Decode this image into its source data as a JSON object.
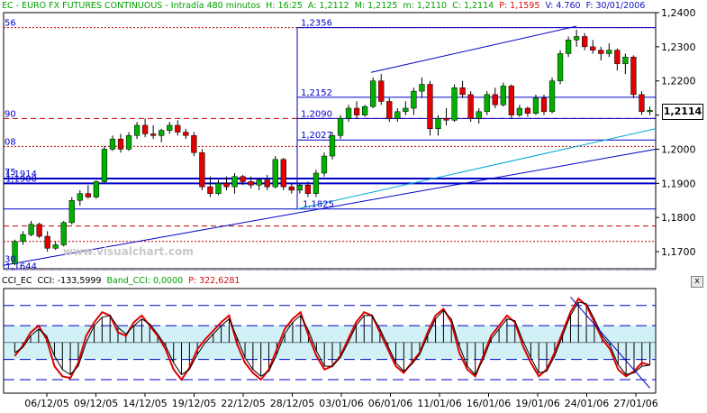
{
  "header": {
    "title": "EC - EURO FX FUTURES CONTINUOUS - Intradía 480 minutos",
    "H": "H: 16:25",
    "A": "A: 1,2112",
    "M": "M: 1,2125",
    "m": "m: 1,2110",
    "C": "C: 1,2114",
    "P": "P: 1,1595",
    "V": "V: 4.760",
    "F": "F: 30/01/2006"
  },
  "watermark": "www.visualchart.com",
  "last_price": "1,2114",
  "cci_header": {
    "label": "CCI_EC",
    "cci": "CCI: -133,5999",
    "band": "Band_CCI: 0,0000",
    "p": "P: 322,6281"
  },
  "close_button": "x",
  "colors": {
    "up": "#00b000",
    "down": "#e00000",
    "trend": "#0000c8",
    "fib_red": "#c00000",
    "cyan": "#00a8d8",
    "cci_line": "#e00000",
    "histo": "#000000",
    "band_fill": "#00b4d0"
  },
  "price_annotations": {
    "levels": [
      "1,2356",
      "1,2152",
      "1,2090",
      "1,2027",
      "1,1825",
      "1,1914",
      "1,1900",
      "1,1644"
    ],
    "left_fib": [
      "56",
      "90",
      "08",
      "75",
      "30"
    ]
  },
  "chart_data": [
    {
      "type": "candlestick",
      "ylabel_ticks": [
        "1,2400",
        "1,2300",
        "1,2200",
        "1,2100",
        "1,2000",
        "1,1900",
        "1,1800",
        "1,1700"
      ],
      "ylim": [
        1.165,
        1.24
      ],
      "x_ticks": [
        "06/12/05",
        "09/12/05",
        "14/12/05",
        "19/12/05",
        "22/12/05",
        "28/12/05",
        "03/01/06",
        "06/01/06",
        "11/01/06",
        "16/01/06",
        "19/01/06",
        "24/01/06",
        "27/01/06"
      ],
      "candles": [
        [
          1.1665,
          1.1735,
          1.166,
          1.173
        ],
        [
          1.173,
          1.176,
          1.172,
          1.175
        ],
        [
          1.175,
          1.179,
          1.1745,
          1.178
        ],
        [
          1.178,
          1.1785,
          1.174,
          1.1745
        ],
        [
          1.1745,
          1.176,
          1.17,
          1.171
        ],
        [
          1.171,
          1.173,
          1.1705,
          1.172
        ],
        [
          1.172,
          1.179,
          1.1715,
          1.1785
        ],
        [
          1.1785,
          1.186,
          1.178,
          1.185
        ],
        [
          1.185,
          1.188,
          1.1835,
          1.187
        ],
        [
          1.187,
          1.1895,
          1.1855,
          1.186
        ],
        [
          1.186,
          1.191,
          1.1855,
          1.1905
        ],
        [
          1.1905,
          1.201,
          1.19,
          1.2
        ],
        [
          1.2,
          1.204,
          1.1995,
          1.203
        ],
        [
          1.203,
          1.2045,
          1.199,
          1.2
        ],
        [
          1.2,
          1.205,
          1.1995,
          1.204
        ],
        [
          1.204,
          1.208,
          1.203,
          1.207
        ],
        [
          1.207,
          1.209,
          1.2035,
          1.2045
        ],
        [
          1.2045,
          1.207,
          1.203,
          1.204
        ],
        [
          1.204,
          1.206,
          1.202,
          1.2055
        ],
        [
          1.2055,
          1.208,
          1.2045,
          1.207
        ],
        [
          1.207,
          1.2085,
          1.204,
          1.205
        ],
        [
          1.205,
          1.206,
          1.203,
          1.204
        ],
        [
          1.204,
          1.205,
          1.198,
          1.199
        ],
        [
          1.199,
          1.2,
          1.188,
          1.189
        ],
        [
          1.189,
          1.192,
          1.186,
          1.187
        ],
        [
          1.187,
          1.191,
          1.1865,
          1.19
        ],
        [
          1.19,
          1.192,
          1.188,
          1.189
        ],
        [
          1.189,
          1.193,
          1.187,
          1.192
        ],
        [
          1.192,
          1.1925,
          1.1895,
          1.1905
        ],
        [
          1.1905,
          1.192,
          1.1885,
          1.1895
        ],
        [
          1.1895,
          1.1915,
          1.188,
          1.191
        ],
        [
          1.191,
          1.1925,
          1.188,
          1.189
        ],
        [
          1.189,
          1.198,
          1.1885,
          1.197
        ],
        [
          1.197,
          1.1975,
          1.188,
          1.189
        ],
        [
          1.189,
          1.19,
          1.187,
          1.188
        ],
        [
          1.188,
          1.19,
          1.187,
          1.1895
        ],
        [
          1.1895,
          1.1905,
          1.186,
          1.187
        ],
        [
          1.187,
          1.194,
          1.186,
          1.193
        ],
        [
          1.193,
          1.199,
          1.192,
          1.198
        ],
        [
          1.198,
          1.205,
          1.197,
          1.204
        ],
        [
          1.204,
          1.21,
          1.203,
          1.209
        ],
        [
          1.209,
          1.213,
          1.208,
          1.212
        ],
        [
          1.212,
          1.214,
          1.209,
          1.21
        ],
        [
          1.21,
          1.213,
          1.2095,
          1.2125
        ],
        [
          1.2125,
          1.221,
          1.212,
          1.22
        ],
        [
          1.22,
          1.222,
          1.213,
          1.214
        ],
        [
          1.214,
          1.215,
          1.208,
          1.209
        ],
        [
          1.209,
          1.212,
          1.208,
          1.211
        ],
        [
          1.211,
          1.214,
          1.21,
          1.212
        ],
        [
          1.212,
          1.218,
          1.21,
          1.217
        ],
        [
          1.217,
          1.221,
          1.215,
          1.219
        ],
        [
          1.219,
          1.22,
          1.204,
          1.206
        ],
        [
          1.206,
          1.21,
          1.204,
          1.209
        ],
        [
          1.209,
          1.212,
          1.207,
          1.2085
        ],
        [
          1.2085,
          1.219,
          1.208,
          1.218
        ],
        [
          1.218,
          1.22,
          1.215,
          1.216
        ],
        [
          1.216,
          1.217,
          1.208,
          1.209
        ],
        [
          1.209,
          1.212,
          1.2075,
          1.211
        ],
        [
          1.211,
          1.217,
          1.21,
          1.216
        ],
        [
          1.216,
          1.218,
          1.212,
          1.213
        ],
        [
          1.213,
          1.2195,
          1.2125,
          1.2185
        ],
        [
          1.2185,
          1.219,
          1.209,
          1.21
        ],
        [
          1.21,
          1.213,
          1.2095,
          1.212
        ],
        [
          1.212,
          1.2125,
          1.2095,
          1.2105
        ],
        [
          1.2105,
          1.216,
          1.21,
          1.215
        ],
        [
          1.215,
          1.216,
          1.21,
          1.211
        ],
        [
          1.211,
          1.221,
          1.2105,
          1.22
        ],
        [
          1.22,
          1.229,
          1.219,
          1.228
        ],
        [
          1.228,
          1.233,
          1.227,
          1.232
        ],
        [
          1.232,
          1.235,
          1.23,
          1.233
        ],
        [
          1.233,
          1.234,
          1.229,
          1.23
        ],
        [
          1.23,
          1.232,
          1.228,
          1.229
        ],
        [
          1.229,
          1.23,
          1.226,
          1.228
        ],
        [
          1.228,
          1.231,
          1.227,
          1.229
        ],
        [
          1.229,
          1.2295,
          1.223,
          1.225
        ],
        [
          1.225,
          1.228,
          1.222,
          1.227
        ],
        [
          1.227,
          1.2275,
          1.215,
          1.216
        ],
        [
          1.216,
          1.217,
          1.21,
          1.211
        ],
        [
          1.211,
          1.2125,
          1.21,
          1.2114
        ]
      ],
      "horizontal_lines": [
        1.2356,
        1.2152,
        1.209,
        1.2027,
        1.1914,
        1.19,
        1.1825,
        1.1644
      ],
      "red_levels": [
        1.2356,
        1.209,
        1.2008,
        1.1775,
        1.173,
        1.1644
      ]
    },
    {
      "type": "line",
      "name": "CCI",
      "ylim": [
        -300,
        320
      ],
      "bands": [
        220,
        100,
        -100,
        -220
      ],
      "cci": [
        -80,
        -20,
        60,
        100,
        20,
        -140,
        -200,
        -210,
        -120,
        40,
        120,
        180,
        160,
        60,
        40,
        120,
        160,
        100,
        40,
        -40,
        -160,
        -220,
        -150,
        -40,
        20,
        70,
        120,
        160,
        -10,
        -120,
        -180,
        -220,
        -160,
        -40,
        80,
        140,
        180,
        40,
        -80,
        -160,
        -140,
        -80,
        20,
        120,
        180,
        160,
        60,
        -40,
        -140,
        -180,
        -120,
        -60,
        60,
        160,
        200,
        120,
        -60,
        -160,
        -200,
        -80,
        40,
        100,
        160,
        120,
        -20,
        -120,
        -200,
        -160,
        -60,
        60,
        180,
        260,
        220,
        120,
        20,
        -40,
        -160,
        -200,
        -170,
        -120,
        -134
      ],
      "histogram": [
        -60,
        -30,
        40,
        80,
        40,
        -80,
        -160,
        -190,
        -140,
        0,
        100,
        150,
        160,
        90,
        50,
        100,
        140,
        110,
        50,
        -20,
        -120,
        -190,
        -160,
        -70,
        0,
        50,
        100,
        140,
        30,
        -90,
        -160,
        -200,
        -170,
        -70,
        50,
        120,
        160,
        70,
        -50,
        -140,
        -140,
        -90,
        0,
        100,
        160,
        160,
        80,
        -20,
        -120,
        -170,
        -130,
        -70,
        40,
        140,
        190,
        140,
        -20,
        -140,
        -190,
        -100,
        20,
        80,
        140,
        130,
        10,
        -90,
        -180,
        -170,
        -80,
        40,
        160,
        240,
        230,
        140,
        40,
        -20,
        -130,
        -190,
        -180,
        -140,
        -134
      ]
    }
  ]
}
